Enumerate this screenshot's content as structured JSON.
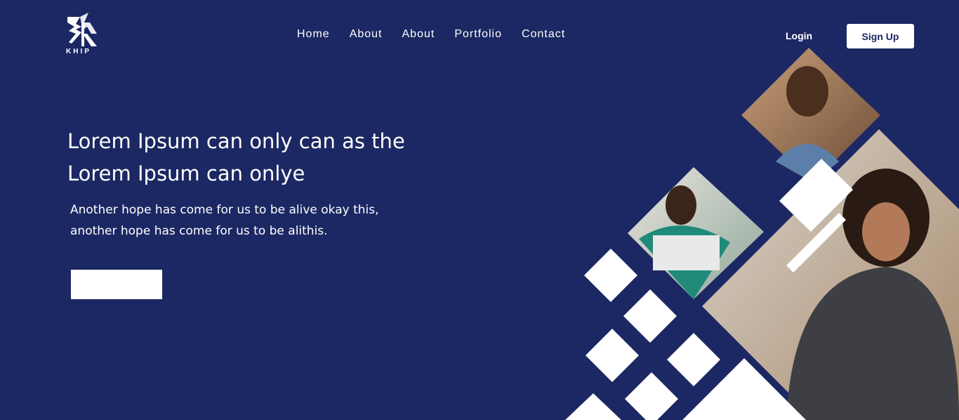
{
  "brand": {
    "logo_text": "KHIP"
  },
  "nav": {
    "items": [
      {
        "label": "Home"
      },
      {
        "label": "About"
      },
      {
        "label": "About"
      },
      {
        "label": "Portfolio"
      },
      {
        "label": "Contact"
      }
    ]
  },
  "auth": {
    "login_label": "Login",
    "signup_label": "Sign Up"
  },
  "hero": {
    "title": "Lorem Ipsum can only can as the Lorem Ipsum can onlye",
    "subtitle": "Another hope has come for us to be alive okay this, another hope has come for us to be alithis.",
    "cta_label": ""
  },
  "colors": {
    "background": "#1c2863",
    "accent": "#ffffff"
  }
}
